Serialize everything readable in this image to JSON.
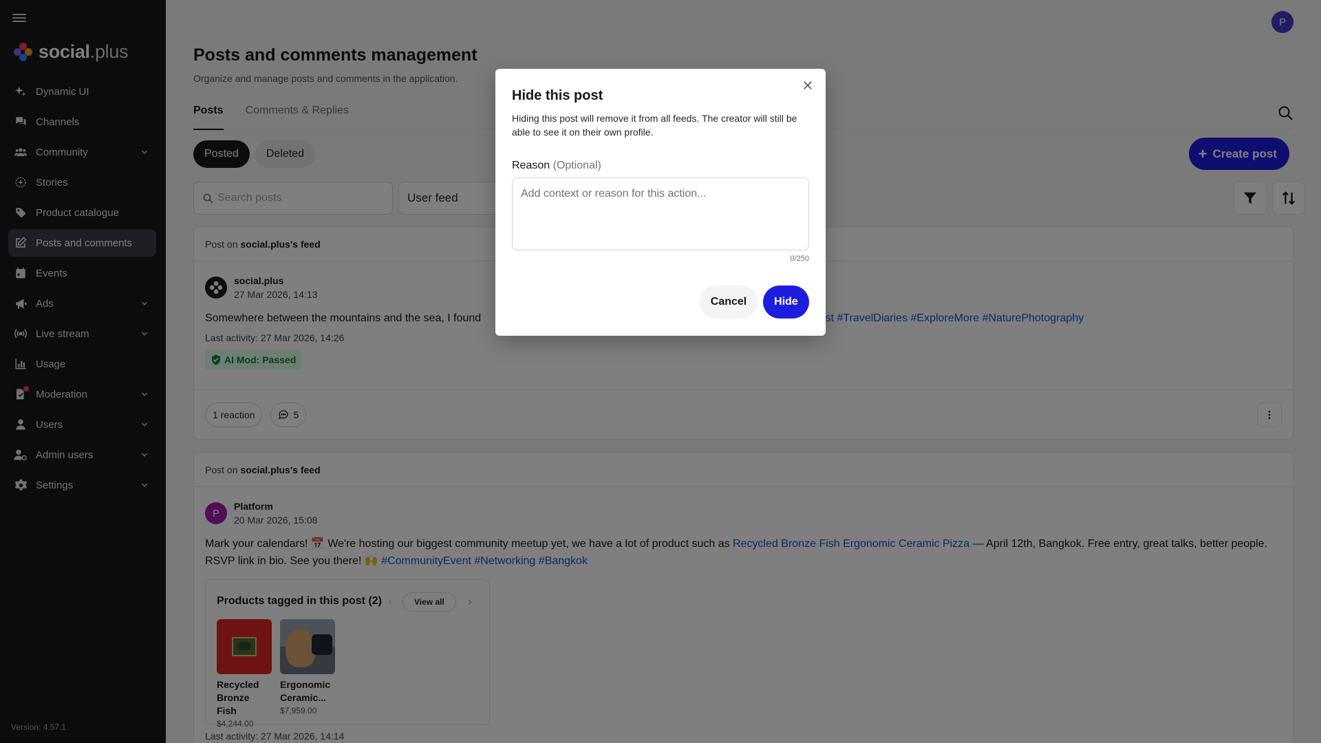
{
  "sidebar": {
    "logo": {
      "brand_bold": "social",
      "brand_rest": ".plus"
    },
    "items": [
      {
        "label": "Dynamic UI",
        "icon": "sparkles-icon",
        "chevron": false
      },
      {
        "label": "Channels",
        "icon": "chat-bubbles-icon",
        "chevron": false
      },
      {
        "label": "Community",
        "icon": "users-group-icon",
        "chevron": true
      },
      {
        "label": "Stories",
        "icon": "story-circle-icon",
        "chevron": false
      },
      {
        "label": "Product catalogue",
        "icon": "tag-icon",
        "chevron": false
      },
      {
        "label": "Posts and comments",
        "icon": "edit-square-icon",
        "chevron": false,
        "active": true
      },
      {
        "label": "Events",
        "icon": "calendar-icon",
        "chevron": false
      },
      {
        "label": "Ads",
        "icon": "megaphone-icon",
        "chevron": true
      },
      {
        "label": "Live stream",
        "icon": "broadcast-icon",
        "chevron": true
      },
      {
        "label": "Usage",
        "icon": "bar-chart-icon",
        "chevron": false
      },
      {
        "label": "Moderation",
        "icon": "moderation-icon",
        "chevron": true
      },
      {
        "label": "Users",
        "icon": "user-icon",
        "chevron": true
      },
      {
        "label": "Admin users",
        "icon": "admin-user-icon",
        "chevron": true
      },
      {
        "label": "Settings",
        "icon": "gear-icon",
        "chevron": true
      }
    ],
    "version": "Version: 4.57.1"
  },
  "header": {
    "avatar_initial": "P"
  },
  "page": {
    "title": "Posts and comments management",
    "subtitle": "Organize and manage posts and comments in the application."
  },
  "tabs": [
    {
      "label": "Posts",
      "active": true
    },
    {
      "label": "Comments & Replies",
      "active": false
    }
  ],
  "filters": {
    "segments": [
      {
        "label": "Posted",
        "active": true
      },
      {
        "label": "Deleted",
        "active": false
      }
    ],
    "create_label": "Create post",
    "search_placeholder": "Search posts",
    "feed_value": "User feed"
  },
  "posts": [
    {
      "head_prefix": "Post on",
      "head_feed": "social.plus's feed",
      "author": "social.plus",
      "date": "27 Mar 2026, 14:13",
      "text_plain": "Somewhere between the mountains and the sea, I found",
      "text_tags": "nderlust #TravelDiaries #ExploreMore #NaturePhotography",
      "last_activity": "Last activity: 27 Mar 2026, 14:26",
      "aimod": "AI Mod: Passed",
      "reactions": "1 reaction",
      "comments": "5"
    },
    {
      "head_prefix": "Post on",
      "head_feed": "social.plus's feed",
      "author_initial": "P",
      "author": "Platform",
      "date": "20 Mar 2026, 15:08",
      "text_1": "Mark your calendars! 📅 We're hosting our biggest community meetup yet, we have a lot of product such as ",
      "text_link": "Recycled Bronze Fish Ergonomic Ceramic Pizza",
      "text_2": " — April 12th, Bangkok. Free entry, great talks, better people. RSVP link in bio. See you there! 🙌 ",
      "text_tags": "#CommunityEvent #Networking #Bangkok",
      "products_title": "Products tagged in this post (2)",
      "view_all": "View all",
      "products": [
        {
          "name": "Recycled Bronze Fish",
          "price": "$4,244.00"
        },
        {
          "name": "Ergonomic Ceramic...",
          "price": "$7,959.00"
        }
      ],
      "last_activity": "Last activity: 27 Mar 2026, 14:14"
    }
  ],
  "modal": {
    "title": "Hide this post",
    "description": "Hiding this post will remove it from all feeds. The creator will still be able to see it on their own profile.",
    "reason_label": "Reason",
    "reason_optional": "(Optional)",
    "reason_placeholder": "Add context or reason for this action...",
    "reason_value": "",
    "char_count": "0/250",
    "cancel_label": "Cancel",
    "hide_label": "Hide"
  },
  "colors": {
    "accent": "#1d1de0",
    "sidebar_bg": "#18181b",
    "link": "#1d4ed8",
    "success_bg": "#dcfce7",
    "success_fg": "#15803d",
    "avatar": "#4338ca",
    "platform_avatar": "#a21caf"
  }
}
